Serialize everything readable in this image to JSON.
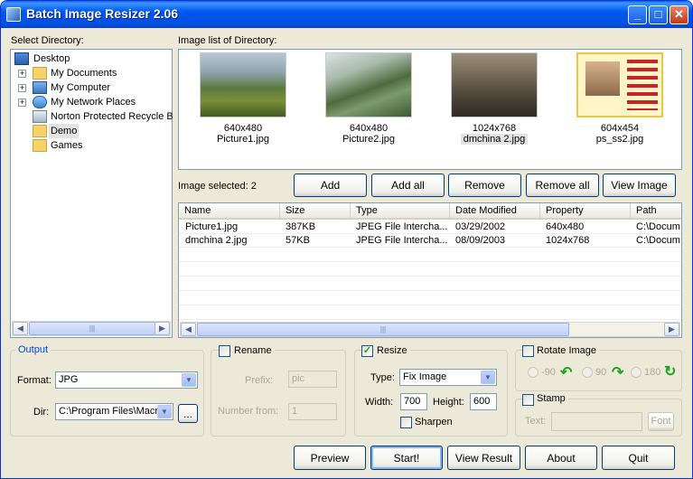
{
  "window": {
    "title": "Batch Image Resizer 2.06",
    "min": "_",
    "max": "□",
    "close": "✕"
  },
  "directory": {
    "label": "Select Directory:",
    "items": [
      {
        "label": "Desktop",
        "icon": "desktop-icon"
      },
      {
        "label": "My Documents",
        "icon": "folder-icon"
      },
      {
        "label": "My Computer",
        "icon": "computer-icon"
      },
      {
        "label": "My Network Places",
        "icon": "network-icon"
      },
      {
        "label": "Norton Protected Recycle B",
        "icon": "recycle-bin-icon"
      },
      {
        "label": "Demo",
        "icon": "folder-icon",
        "selected": true
      },
      {
        "label": "Games",
        "icon": "folder-icon"
      }
    ],
    "expander": "+"
  },
  "image_list": {
    "label": "Image list of Directory:",
    "thumbs": [
      {
        "size": "640x480",
        "name": "Picture1.jpg"
      },
      {
        "size": "640x480",
        "name": "Picture2.jpg"
      },
      {
        "size": "1024x768",
        "name": "dmchina 2.jpg"
      },
      {
        "size": "604x454",
        "name": "ps_ss2.jpg"
      }
    ]
  },
  "selection": {
    "label": "Image selected: 2"
  },
  "actions": {
    "add": "Add",
    "add_all": "Add all",
    "remove": "Remove",
    "remove_all": "Remove all",
    "view_image": "View Image"
  },
  "table": {
    "headers": [
      "Name",
      "Size",
      "Type",
      "Date Modified",
      "Property",
      "Path"
    ],
    "rows": [
      [
        "Picture1.jpg",
        "387KB",
        "JPEG File Intercha...",
        "03/29/2002",
        "640x480",
        "C:\\Docum"
      ],
      [
        "dmchina 2.jpg",
        "57KB",
        "JPEG File Intercha...",
        "08/09/2003",
        "1024x768",
        "C:\\Docum"
      ]
    ]
  },
  "output": {
    "title": "Output",
    "format_label": "Format:",
    "format_value": "JPG",
    "dir_label": "Dir:",
    "dir_value": "C:\\Program Files\\Macr",
    "browse": "..."
  },
  "rename": {
    "label": "Rename",
    "checked": false,
    "prefix_label": "Prefix:",
    "prefix_value": "pic",
    "number_label": "Number from:",
    "number_value": "1"
  },
  "resize": {
    "label": "Resize",
    "checked": true,
    "type_label": "Type:",
    "type_value": "Fix Image",
    "width_label": "Width:",
    "width_value": "700",
    "height_label": "Height:",
    "height_value": "600",
    "sharpen_label": "Sharpen"
  },
  "rotate": {
    "label": "Rotate Image",
    "options": [
      "-90",
      "90",
      "180"
    ]
  },
  "stamp": {
    "label": "Stamp",
    "text_label": "Text:",
    "font_button": "Font"
  },
  "footer": {
    "preview": "Preview",
    "start": "Start!",
    "view_result": "View Result",
    "about": "About",
    "quit": "Quit"
  },
  "colors": {
    "titlebar": "#0058ee",
    "accent_green": "#21a121",
    "window_bg": "#ece9d8",
    "selection_bg": "#e3e3e3"
  }
}
